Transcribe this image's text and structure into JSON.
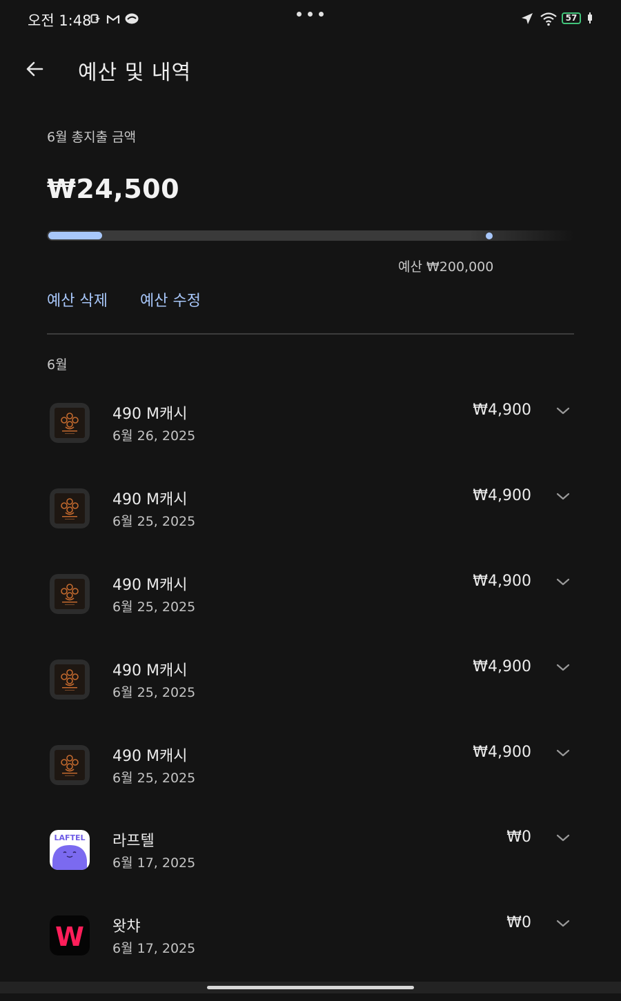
{
  "status_bar": {
    "time": "오전 1:48",
    "battery": "57",
    "icons": [
      "nfc-icon",
      "gmail-icon",
      "cloud-icon",
      "more-dots-icon",
      "navigation-icon",
      "wifi-icon",
      "battery-icon",
      "charging-icon"
    ]
  },
  "header": {
    "title": "예산 및 내역"
  },
  "summary": {
    "label": "6월 총지출 금액",
    "total": "₩24,500",
    "budget_caption": "예산 ₩200,000",
    "spent_fraction": 0.1225,
    "budget_marker_fraction": 1.0
  },
  "actions": {
    "delete": "예산 삭제",
    "edit": "예산 수정"
  },
  "section": {
    "month": "6월"
  },
  "transactions": [
    {
      "name": "490 M캐시",
      "date": "6월 26, 2025",
      "amount": "₩4,900",
      "icon": "mabinogi-icon"
    },
    {
      "name": "490 M캐시",
      "date": "6월 25, 2025",
      "amount": "₩4,900",
      "icon": "mabinogi-icon"
    },
    {
      "name": "490 M캐시",
      "date": "6월 25, 2025",
      "amount": "₩4,900",
      "icon": "mabinogi-icon"
    },
    {
      "name": "490 M캐시",
      "date": "6월 25, 2025",
      "amount": "₩4,900",
      "icon": "mabinogi-icon"
    },
    {
      "name": "490 M캐시",
      "date": "6월 25, 2025",
      "amount": "₩4,900",
      "icon": "mabinogi-icon"
    },
    {
      "name": "라프텔",
      "date": "6월 17, 2025",
      "amount": "₩0",
      "icon": "laftel-icon",
      "logo_text": "LAFTEL"
    },
    {
      "name": "왓챠",
      "date": "6월 17, 2025",
      "amount": "₩0",
      "icon": "watcha-icon",
      "logo_text": "W"
    }
  ],
  "colors": {
    "background": "#141414",
    "accent": "#a8c7fa",
    "track": "#3a3a3a",
    "battery": "#41c47a"
  }
}
